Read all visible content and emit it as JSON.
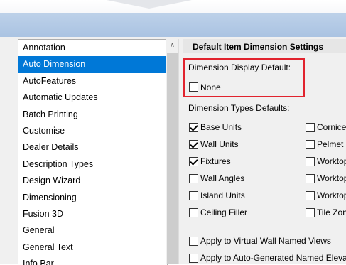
{
  "nav": {
    "items": [
      {
        "label": "Annotation",
        "selected": false
      },
      {
        "label": "Auto Dimension",
        "selected": true
      },
      {
        "label": "AutoFeatures",
        "selected": false
      },
      {
        "label": "Automatic Updates",
        "selected": false
      },
      {
        "label": "Batch Printing",
        "selected": false
      },
      {
        "label": "Customise",
        "selected": false
      },
      {
        "label": "Dealer Details",
        "selected": false
      },
      {
        "label": "Description Types",
        "selected": false
      },
      {
        "label": "Design Wizard",
        "selected": false
      },
      {
        "label": "Dimensioning",
        "selected": false
      },
      {
        "label": "Fusion 3D",
        "selected": false
      },
      {
        "label": "General",
        "selected": false
      },
      {
        "label": "General Text",
        "selected": false
      },
      {
        "label": "Info Bar",
        "selected": false
      }
    ],
    "scroll_up_glyph": "∧"
  },
  "panel": {
    "title": "Default Item Dimension Settings",
    "display_default_label": "Dimension Display Default:",
    "none_label": "None",
    "none_checked": false,
    "types_label": "Dimension Types Defaults:",
    "left_checks": [
      {
        "label": "Base Units",
        "checked": true
      },
      {
        "label": "Wall Units",
        "checked": true
      },
      {
        "label": "Fixtures",
        "checked": true
      },
      {
        "label": "Wall Angles",
        "checked": false
      },
      {
        "label": "Island Units",
        "checked": false
      },
      {
        "label": "Ceiling Filler",
        "checked": false
      }
    ],
    "right_checks": [
      {
        "label": "Cornice",
        "checked": false
      },
      {
        "label": "Pelmet",
        "checked": false
      },
      {
        "label": "Worktop",
        "checked": false
      },
      {
        "label": "Worktop",
        "checked": false
      },
      {
        "label": "Worktop",
        "checked": false
      },
      {
        "label": "Tile Zone",
        "checked": false
      }
    ],
    "apply_virtual": "Apply to Virtual Wall Named Views",
    "apply_virtual_checked": false,
    "apply_auto": "Apply to Auto-Generated Named Elevations",
    "apply_auto_checked": false
  },
  "colors": {
    "selection": "#0078d7",
    "highlight": "#e1232e",
    "header_band": "#b3cae6"
  }
}
